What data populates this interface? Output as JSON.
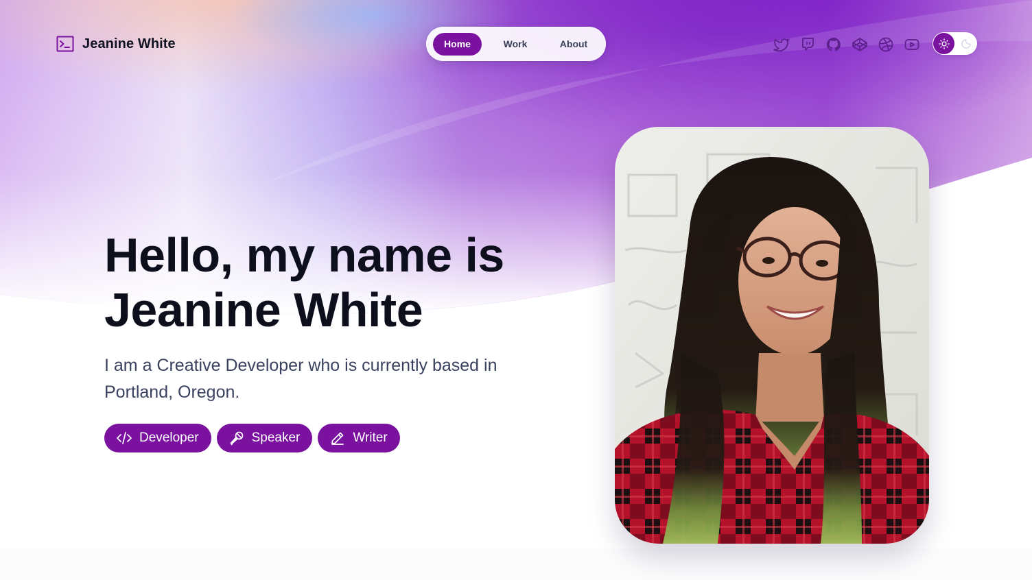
{
  "brand": {
    "name": "Jeanine White",
    "logo_icon": "terminal-icon",
    "accent_color": "#7a119f"
  },
  "nav": {
    "items": [
      {
        "label": "Home",
        "active": true
      },
      {
        "label": "Work",
        "active": false
      },
      {
        "label": "About",
        "active": false
      }
    ]
  },
  "socials": [
    {
      "icon": "twitter-icon"
    },
    {
      "icon": "twitch-icon"
    },
    {
      "icon": "github-icon"
    },
    {
      "icon": "codepen-icon"
    },
    {
      "icon": "dribbble-icon"
    },
    {
      "icon": "youtube-icon"
    }
  ],
  "theme_toggle": {
    "selected": "light",
    "icons": [
      "sun-icon",
      "moon-icon"
    ]
  },
  "hero": {
    "title_line1": "Hello, my name is",
    "title_line2": "Jeanine White",
    "subtitle": "I am a Creative Developer who is currently based in Portland, Oregon.",
    "tags": [
      {
        "label": "Developer",
        "icon": "code-icon"
      },
      {
        "label": "Speaker",
        "icon": "microphone-icon"
      },
      {
        "label": "Writer",
        "icon": "pencil-icon"
      }
    ]
  },
  "photo": {
    "subject": "portrait-photo"
  }
}
